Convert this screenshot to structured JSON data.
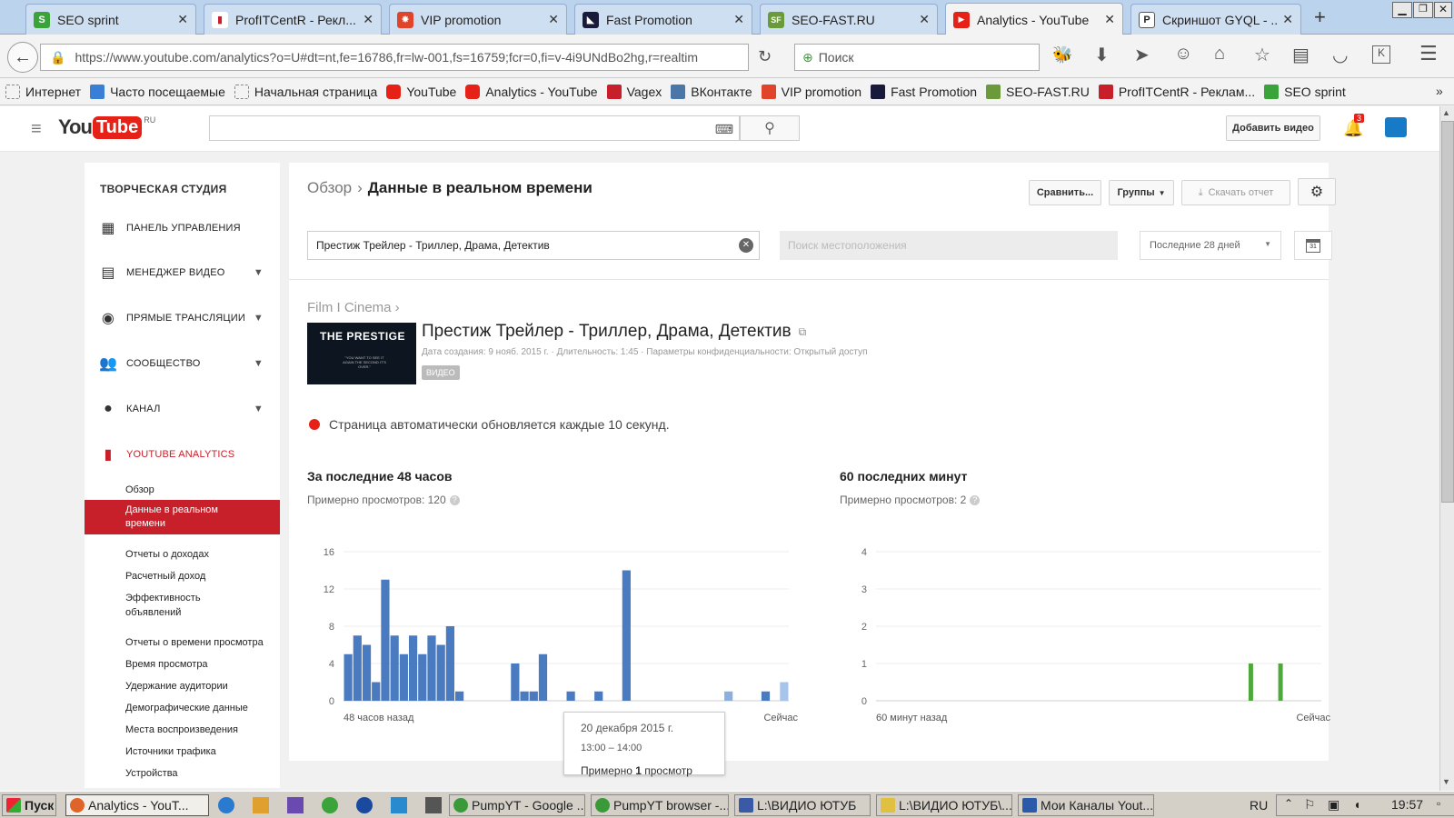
{
  "browser": {
    "tabs": [
      {
        "label": "SEO sprint",
        "color": "#3aa43a",
        "glyph": "S"
      },
      {
        "label": "ProfITCentR - Рекл...",
        "color": "#c8202a",
        "glyph": "▮"
      },
      {
        "label": "VIP promotion",
        "color": "#e0442a",
        "glyph": "✸"
      },
      {
        "label": "Fast Promotion",
        "color": "#1a1a3a",
        "glyph": "◣"
      },
      {
        "label": "SEO-FAST.RU",
        "color": "#6a9a3a",
        "glyph": "SF"
      },
      {
        "label": "Analytics - YouTube",
        "color": "#e62117",
        "glyph": "▶"
      },
      {
        "label": "Скриншот GYQL - ...",
        "color": "#ffffff",
        "glyph": "P"
      }
    ],
    "url": "https://www.youtube.com/analytics?o=U#dt=nt,fe=16786,fr=lw-001,fs=16759;fcr=0,fi=v-4i9UNdBo2hg,r=realtim",
    "search_placeholder": "Поиск",
    "bookmarks": [
      {
        "label": "Интернет",
        "color": "#ffffff"
      },
      {
        "label": "Часто посещаемые",
        "color": "#3a7fd6"
      },
      {
        "label": "Начальная страница",
        "color": "#ffffff"
      },
      {
        "label": "YouTube",
        "color": "#e62117"
      },
      {
        "label": "Analytics - YouTube",
        "color": "#e62117"
      },
      {
        "label": "Vagex",
        "color": "#c8202a"
      },
      {
        "label": "ВКонтакте",
        "color": "#4a76a8"
      },
      {
        "label": "VIP promotion",
        "color": "#e0442a"
      },
      {
        "label": "Fast Promotion",
        "color": "#1a1a3a"
      },
      {
        "label": "SEO-FAST.RU",
        "color": "#6a9a3a"
      },
      {
        "label": "ProfITCentR - Реклам...",
        "color": "#c8202a"
      },
      {
        "label": "SEO sprint",
        "color": "#3aa43a"
      }
    ]
  },
  "youtube": {
    "logo_you": "You",
    "logo_tube": "Tube",
    "logo_region": "RU",
    "upload_label": "Добавить видео",
    "notification_count": "3"
  },
  "sidebar": {
    "title": "ТВОРЧЕСКАЯ СТУДИЯ",
    "nav": [
      {
        "label": "ПАНЕЛЬ УПРАВЛЕНИЯ",
        "icon": "dashboard-icon"
      },
      {
        "label": "МЕНЕДЖЕР ВИДЕО",
        "icon": "video-manager-icon"
      },
      {
        "label": "ПРЯМЫЕ ТРАНСЛЯЦИИ",
        "icon": "live-icon"
      },
      {
        "label": "СООБЩЕСТВО",
        "icon": "community-icon"
      },
      {
        "label": "КАНАЛ",
        "icon": "channel-icon"
      },
      {
        "label": "YOUTUBE ANALYTICS",
        "icon": "analytics-icon"
      }
    ],
    "sub": [
      "Обзор",
      "Данные в реальном времени",
      "Отчеты о доходах",
      "Расчетный доход",
      "Эффективность объявлений",
      "Отчеты о времени просмотра",
      "Время просмотра",
      "Удержание аудитории",
      "Демографические данные",
      "Места воспроизведения",
      "Источники трафика",
      "Устройства"
    ]
  },
  "main": {
    "breadcrumb_root": "Обзор",
    "breadcrumb_sep": "›",
    "title": "Данные в реальном времени",
    "compare_label": "Сравнить...",
    "groups_label": "Группы",
    "download_label": "Скачать отчет",
    "filter_value": "Престиж Трейлер - Триллер, Драма, Детектив",
    "location_placeholder": "Поиск местоположения",
    "range_label": "Последние 28 дней",
    "calendar_day": "31",
    "channel": "Film I Cinema ›",
    "video_title": "Престиж Трейлер - Триллер, Драма, Детектив",
    "video_meta": "Дата создания: 9 нояб. 2015 г.  ·  Длительность: 1:45  ·  Параметры конфиденциальности: Открытый доступ",
    "video_badge": "ВИДЕО",
    "thumb_text": "THE PRESTIGE",
    "thumb_tagline": "\"YOU WANT TO SEE IT AGAIN THE SECOND IT'S OVER.\"",
    "auto_refresh": "Страница автоматически обновляется каждые 10 секунд.",
    "tooltip_date": "20 декабря 2015 г.",
    "tooltip_time": "13:00 – 14:00",
    "tooltip_views_prefix": "Примерно ",
    "tooltip_views_bold": "1",
    "tooltip_views_suffix": " просмотр"
  },
  "chart_data": [
    {
      "type": "bar",
      "title": "За последние 48 часов",
      "subtitle": "Примерно просмотров: 120",
      "x_start_label": "48 часов назад",
      "x_end_label": "Сейчас",
      "yticks": [
        "16",
        "12",
        "8",
        "4",
        "0"
      ],
      "ylim": [
        0,
        16
      ],
      "color": "#4a7bc0",
      "values": [
        5,
        7,
        6,
        2,
        13,
        7,
        5,
        7,
        5,
        7,
        6,
        8,
        1,
        0,
        0,
        0,
        0,
        0,
        4,
        1,
        1,
        5,
        0,
        0,
        1,
        0,
        0,
        1,
        0,
        0,
        14,
        0,
        0,
        0,
        0,
        0,
        0,
        0,
        0,
        0,
        0,
        1,
        0,
        0,
        0,
        1,
        0,
        2
      ],
      "highlight_index": 41
    },
    {
      "type": "bar",
      "title": "60 последних минут",
      "subtitle": "Примерно просмотров: 2",
      "x_start_label": "60 минут назад",
      "x_end_label": "Сейчас",
      "yticks": [
        "4",
        "3",
        "2",
        "1",
        "0"
      ],
      "ylim": [
        0,
        4
      ],
      "color": "#4ea83c",
      "values": [
        0,
        0,
        0,
        0,
        0,
        0,
        0,
        0,
        0,
        0,
        0,
        0,
        0,
        0,
        0,
        0,
        0,
        0,
        0,
        0,
        0,
        0,
        0,
        0,
        0,
        0,
        0,
        0,
        0,
        0,
        0,
        0,
        0,
        0,
        0,
        0,
        0,
        0,
        0,
        0,
        0,
        0,
        0,
        0,
        0,
        0,
        0,
        0,
        0,
        0,
        1,
        0,
        0,
        0,
        1,
        0,
        0,
        0,
        0,
        0
      ]
    }
  ],
  "taskbar": {
    "start": "Пуск",
    "items": [
      {
        "label": "Analytics - YouT...",
        "color": "#e0642a"
      },
      {
        "label": "PumpYT - Google ...",
        "color": "#3a9a3a"
      },
      {
        "label": "PumpYT browser -...",
        "color": "#3a9a3a"
      },
      {
        "label": "L:\\ВИДИО ЮТУБ",
        "color": "#3a5aa8"
      },
      {
        "label": "L:\\ВИДИО ЮТУБ\\...",
        "color": "#e0c040"
      },
      {
        "label": "Мои Каналы Yout...",
        "color": "#2a5aa8"
      }
    ],
    "lang": "RU",
    "clock": "19:57"
  }
}
